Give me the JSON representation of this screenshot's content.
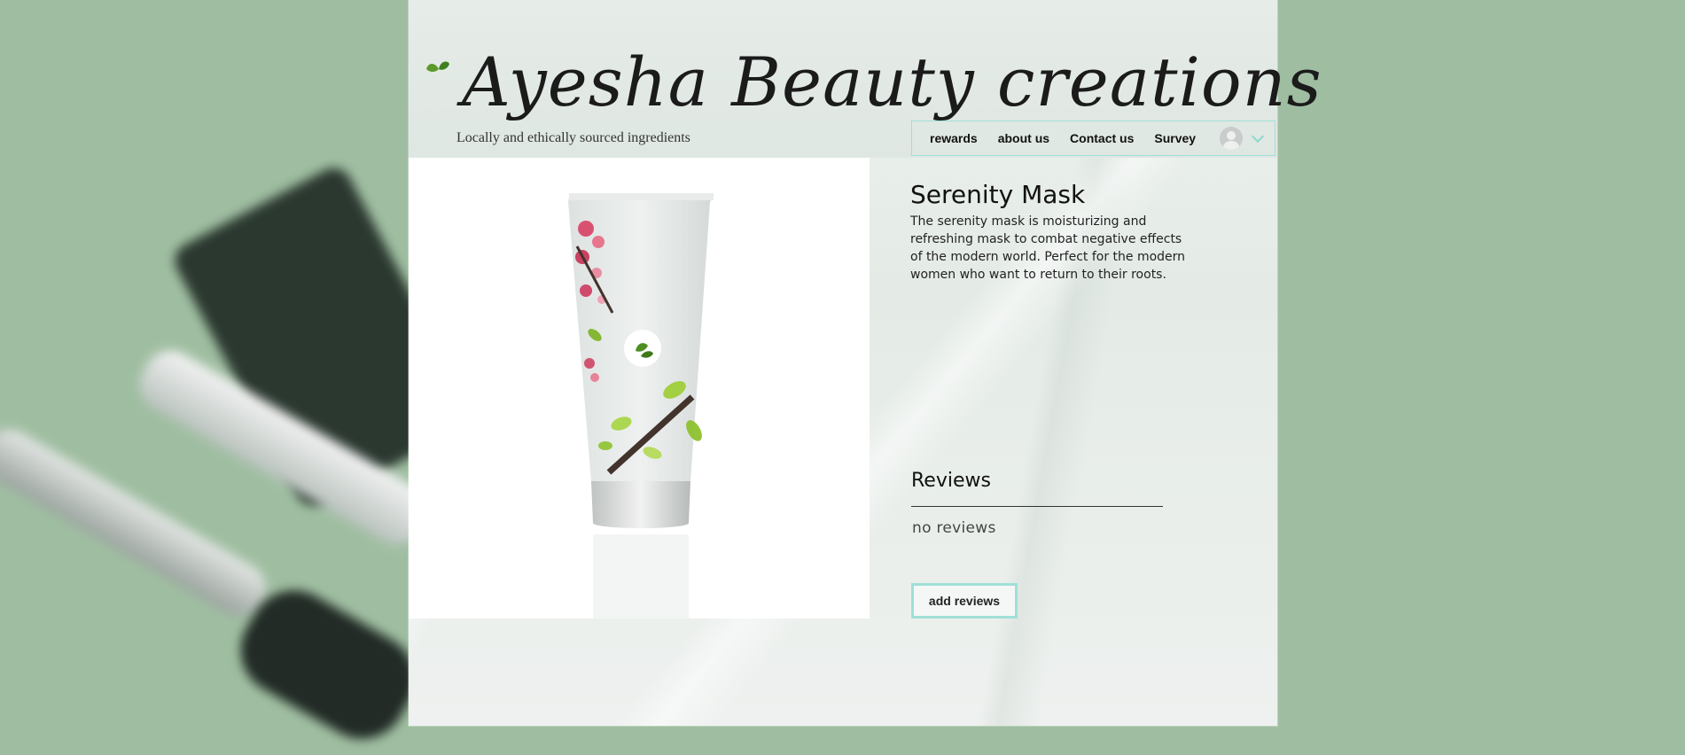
{
  "site": {
    "title": "Ayesha Beauty creations",
    "tagline": "Locally and ethically sourced ingredients",
    "logo_icon": "leaf-icon"
  },
  "nav": {
    "items": [
      {
        "label": "rewards"
      },
      {
        "label": "about us"
      },
      {
        "label": "Contact us"
      },
      {
        "label": "Survey"
      }
    ],
    "login_icon": "user-avatar-icon",
    "dropdown_icon": "chevron-down-icon"
  },
  "product": {
    "name": "Serenity Mask",
    "description": " The serenity mask is moisturizing and refreshing mask to combat negative effects of the modern world. Perfect for the modern women who want to return to their roots.",
    "image_icon": "product-tube-image"
  },
  "reviews": {
    "heading": "Reviews",
    "empty_text": "no reviews",
    "add_button_label": "add reviews"
  },
  "colors": {
    "accent": "#9fe0d6",
    "background": "#9fbea1",
    "leaf_green": "#5a9a2a"
  }
}
